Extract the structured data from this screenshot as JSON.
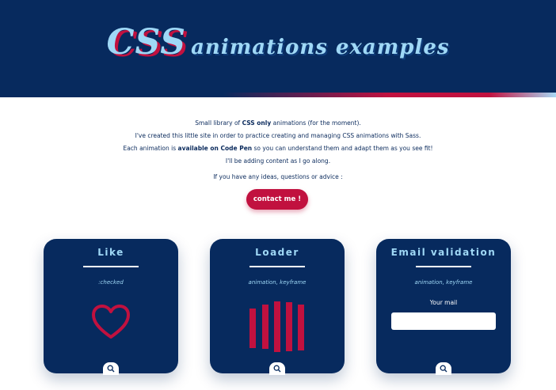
{
  "header": {
    "title_main": "CSS",
    "title_rest": "animations examples"
  },
  "intro": {
    "line1_a": "Small library of ",
    "line1_b": "CSS only",
    "line1_c": " animations (for the moment).",
    "line2": "I've created this little site in order to practice creating and managing CSS animations with Sass.",
    "line3_a": "Each animation is ",
    "line3_b": "available on Code Pen",
    "line3_c": " so you can understand them and adapt them as you see fit!",
    "line4": "I'll be adding content as I go along.",
    "ideas": "If you have any ideas, questions or advice :",
    "contact_label": "contact me !"
  },
  "cards": [
    {
      "title": "Like",
      "tags": ":checked"
    },
    {
      "title": "Loader",
      "tags": "animation, keyframe"
    },
    {
      "title": "Email validation",
      "tags": "animation, keyframe",
      "mail_label": "Your mail",
      "mail_value": ""
    }
  ],
  "icons": {
    "zoom": "search-icon",
    "heart": "heart-icon"
  },
  "colors": {
    "navy": "#072a5e",
    "accent": "#c1113f",
    "light_blue": "#9fd8f6"
  }
}
